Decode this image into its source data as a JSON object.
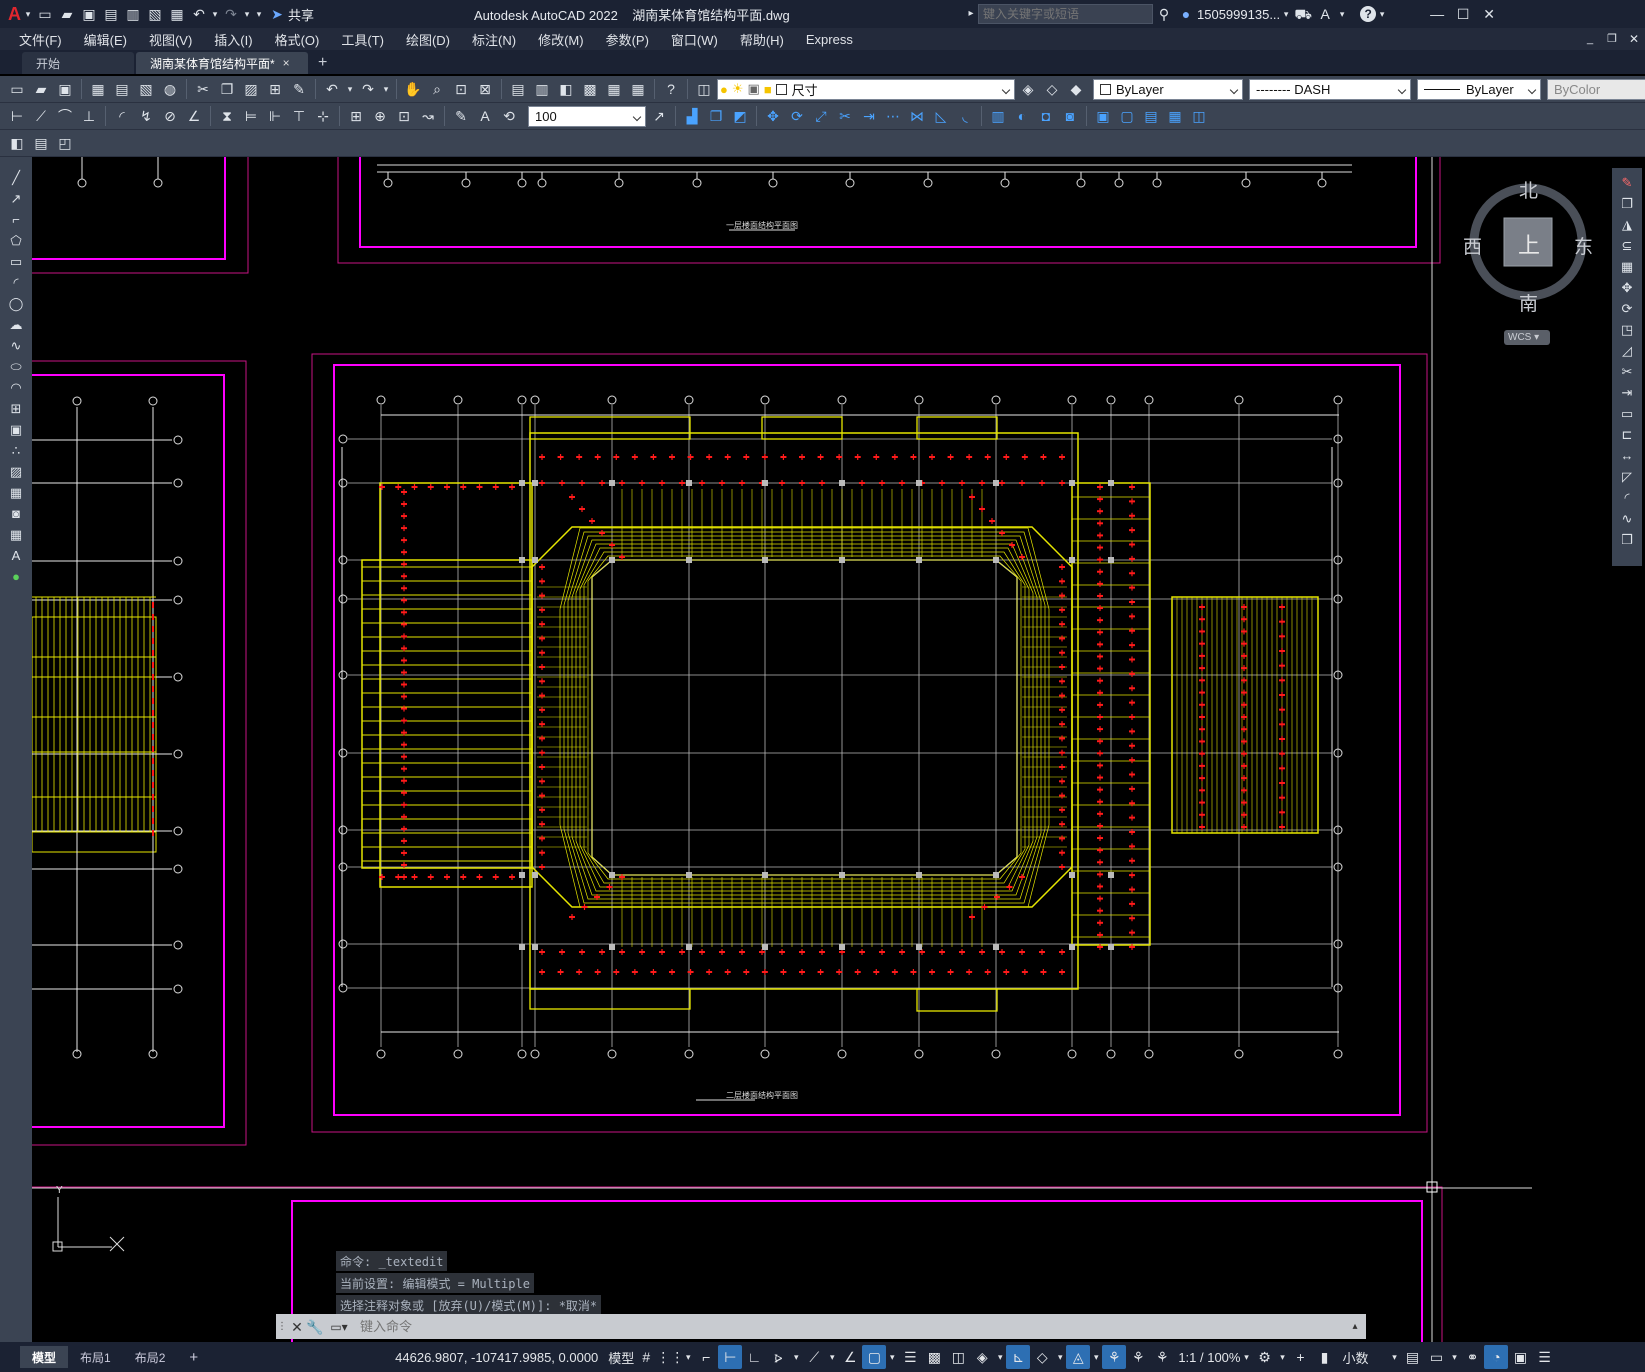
{
  "app": {
    "title": "Autodesk AutoCAD 2022",
    "filename": "湖南某体育馆结构平面.dwg",
    "logo": "A"
  },
  "titlebar": {
    "share": "共享",
    "search_placeholder": "键入关键字或短语",
    "user": "1505999135...",
    "help": "?"
  },
  "menu": [
    "文件(F)",
    "编辑(E)",
    "视图(V)",
    "插入(I)",
    "格式(O)",
    "工具(T)",
    "绘图(D)",
    "标注(N)",
    "修改(M)",
    "参数(P)",
    "窗口(W)",
    "帮助(H)",
    "Express"
  ],
  "tabs": {
    "start": "开始",
    "drawing": "湖南某体育馆结构平面*",
    "close": "×",
    "add": "+"
  },
  "layer": {
    "name": "尺寸"
  },
  "properties": {
    "color": "ByLayer",
    "linetype": "-------- DASH",
    "lineweight": "ByLayer",
    "plotstyle": "ByColor"
  },
  "dimscale": "100",
  "viewcube": {
    "north": "北",
    "south": "南",
    "east": "东",
    "west": "西",
    "top": "上",
    "wcs": "WCS"
  },
  "drawing": {
    "title_upper": "一层楼面结构平面图",
    "title_main": "二层楼面结构平面图"
  },
  "command": {
    "history": [
      "命令: _textedit",
      "当前设置: 编辑模式 = Multiple",
      "选择注释对象或 [放弃(U)/模式(M)]: *取消*"
    ],
    "placeholder": "键入命令"
  },
  "layouts": [
    "模型",
    "布局1",
    "布局2",
    "+"
  ],
  "status": {
    "coords": "44626.9807, -107417.9985, 0.0000",
    "model": "模型",
    "scale": "1:1 / 100%",
    "units": "小数"
  }
}
